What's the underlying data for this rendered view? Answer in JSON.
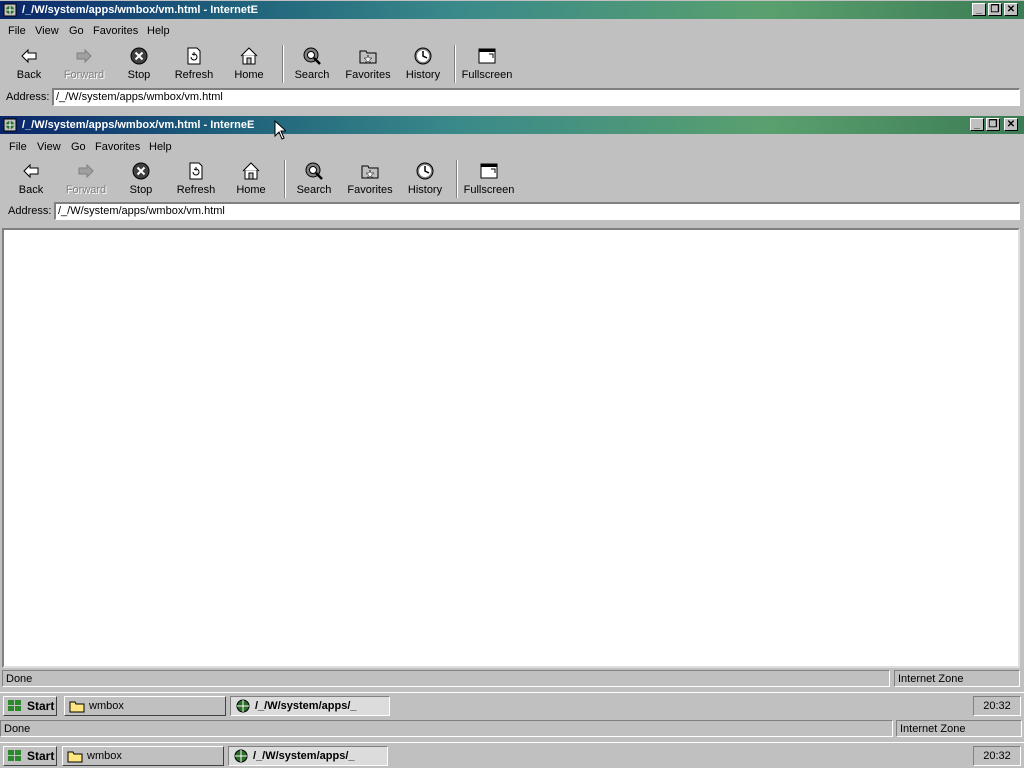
{
  "window1": {
    "title": "/_/W/system/apps/wmbox/vm.html - InternetE",
    "menu": [
      "File",
      "View",
      "Go",
      "Favorites",
      "Help"
    ],
    "toolbar": {
      "back": "Back",
      "forward": "Forward",
      "stop": "Stop",
      "refresh": "Refresh",
      "home": "Home",
      "search": "Search",
      "favorites": "Favorites",
      "history": "History",
      "fullscreen": "Fullscreen"
    },
    "address_label": "Address:",
    "address_value": "/_/W/system/apps/wmbox/vm.html",
    "status_text": "Done",
    "status_zone": "Internet Zone"
  },
  "window2": {
    "title": "/_/W/system/apps/wmbox/vm.html - InterneE",
    "menu": [
      "File",
      "View",
      "Go",
      "Favorites",
      "Help"
    ],
    "toolbar": {
      "back": "Back",
      "forward": "Forward",
      "stop": "Stop",
      "refresh": "Refresh",
      "home": "Home",
      "search": "Search",
      "favorites": "Favorites",
      "history": "History",
      "fullscreen": "Fullscreen"
    },
    "address_label": "Address:",
    "address_value": "/_/W/system/apps/wmbox/vm.html",
    "status_text": "Done",
    "status_zone": "Internet Zone"
  },
  "taskbar_inner": {
    "start": "Start",
    "tasks": [
      "wmbox",
      "/_/W/system/apps/_"
    ],
    "clock": "20:32"
  },
  "outer_status": {
    "status_text": "Done",
    "status_zone": "Internet Zone"
  },
  "taskbar_outer": {
    "start": "Start",
    "tasks": [
      "wmbox",
      "/_/W/system/apps/_"
    ],
    "clock": "20:32"
  },
  "colors": {
    "face": "#c0c0c0",
    "title_start": "#0a246a",
    "title_end": "#3c7c55",
    "content": "#ffffff"
  }
}
